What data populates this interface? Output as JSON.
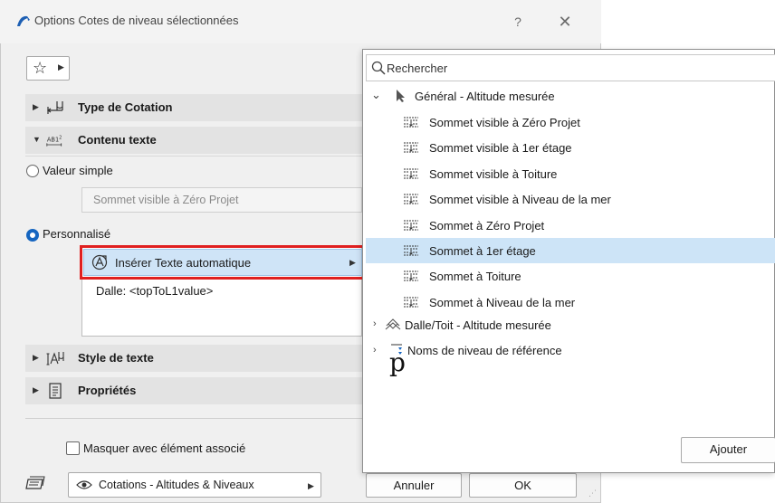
{
  "dialog": {
    "title": "Options Cotes de niveau sélectionnées",
    "help": "?",
    "close": "✕",
    "favorites_icon": "star-icon"
  },
  "sections": {
    "type_cotation": "Type de Cotation",
    "contenu_texte": "Contenu texte",
    "style_texte": "Style de texte",
    "proprietes": "Propriétés"
  },
  "content": {
    "simple_label": "Valeur simple",
    "simple_value": "Sommet visible à Zéro Projet",
    "custom_label": "Personnalisé",
    "insert_label": "Insérer Texte automatique",
    "custom_text": "Dalle: <topToL1value>"
  },
  "footer": {
    "hide_label": "Masquer avec élément associé",
    "layer_value": "Cotations - Altitudes & Niveaux",
    "cancel": "Annuler",
    "ok": "OK"
  },
  "popup": {
    "search_placeholder": "Rechercher",
    "group1": "Général - Altitude mesurée",
    "items": [
      "Sommet visible à Zéro Projet",
      "Sommet visible à 1er étage",
      "Sommet visible à Toiture",
      "Sommet visible à Niveau de la mer",
      "Sommet à Zéro Projet",
      "Sommet à 1er étage",
      "Sommet à Toiture",
      "Sommet à Niveau de la mer"
    ],
    "selected_index": 5,
    "group2": "Dalle/Toit - Altitude mesurée",
    "group3": "Noms de niveau de référence",
    "stray_glyph": "p",
    "add": "Ajouter"
  },
  "colors": {
    "accent": "#1565c0",
    "selection": "#cde4f7",
    "highlight_frame": "#e02020"
  }
}
